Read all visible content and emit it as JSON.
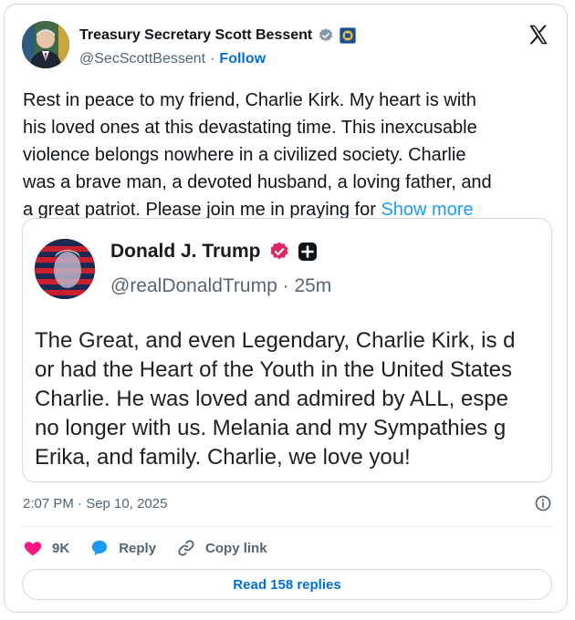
{
  "author": {
    "display_name": "Treasury Secretary Scott Bessent",
    "handle": "@SecScottBessent",
    "separator": "·",
    "follow_label": "Follow"
  },
  "tweet": {
    "text": "Rest in peace to my friend, Charlie Kirk. My heart is with\nhis loved ones at this devastating time. This inexcusable\nviolence belongs nowhere in a civilized society. Charlie\nwas a brave man, a devoted husband, a loving father, and\na great patriot. Please join me in praying for ",
    "show_more_label": "Show more"
  },
  "quoted": {
    "display_name": "Donald J. Trump",
    "handle_time": "@realDonaldTrump · 25m",
    "text": "The Great, and even Legendary, Charlie Kirk, is d\nor had the Heart of the Youth in the United States\nCharlie. He was loved and admired by ALL, espe\nno longer with us. Melania and my Sympathies g\nErika, and family. Charlie, we love you!"
  },
  "meta": {
    "timestamp": "2:07 PM · Sep 10, 2025"
  },
  "actions": {
    "likes": "9K",
    "reply_label": "Reply",
    "copy_link_label": "Copy link"
  },
  "read_replies_label": "Read 158 replies",
  "colors": {
    "like": "#f91880",
    "reply": "#1d9bf0",
    "link": "#006fd6",
    "verified_gray": "#829aab",
    "verified_gold": "#e0245e"
  }
}
